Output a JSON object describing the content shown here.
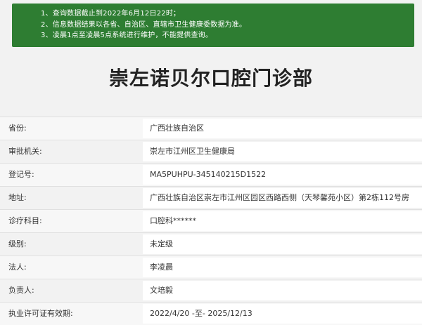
{
  "notice": {
    "lines": [
      "1、查询数据截止到2022年6月12日22时；",
      "2、信息数据结果以各省、自治区、直辖市卫生健康委数据为准。",
      "3、凌晨1点至凌晨5点系统进行维护，不能提供查询。"
    ]
  },
  "title": "崇左诺贝尔口腔门诊部",
  "rows": [
    {
      "label": "省份:",
      "value": "广西壮族自治区"
    },
    {
      "label": "审批机关:",
      "value": "崇左市江州区卫生健康局"
    },
    {
      "label": "登记号:",
      "value": "MA5PUHPU-345140215D1522"
    },
    {
      "label": "地址:",
      "value": "广西壮族自治区崇左市江州区园区西路西侧（天琴馨苑小区）第2栋112号房"
    },
    {
      "label": "诊疗科目:",
      "value": "口腔科******"
    },
    {
      "label": "级别:",
      "value": "未定级"
    },
    {
      "label": "法人:",
      "value": "李凌晨"
    },
    {
      "label": "负责人:",
      "value": "文培毅"
    },
    {
      "label": "执业许可证有效期:",
      "value": "2022/4/20 -至- 2025/12/13"
    }
  ],
  "colors": {
    "notice_bg": "#2e7d32",
    "notice_text": "#ffffff",
    "page_bg": "#f2f2f2",
    "value_bg": "#ffffff"
  }
}
